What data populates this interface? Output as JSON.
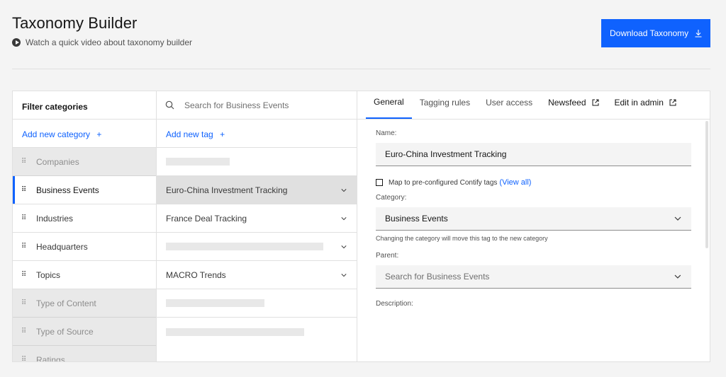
{
  "header": {
    "title": "Taxonomy Builder",
    "video_link": "Watch a quick video about taxonomy builder",
    "download_label": "Download Taxonomy"
  },
  "categories": {
    "header": "Filter categories",
    "add_label": "Add new category",
    "items": [
      {
        "label": "Companies",
        "state": "disabled"
      },
      {
        "label": "Business Events",
        "state": "active"
      },
      {
        "label": "Industries",
        "state": "normal"
      },
      {
        "label": "Headquarters",
        "state": "normal"
      },
      {
        "label": "Topics",
        "state": "normal"
      },
      {
        "label": "Type of Content",
        "state": "disabled"
      },
      {
        "label": "Type of Source",
        "state": "disabled"
      },
      {
        "label": "Ratings",
        "state": "disabled"
      }
    ]
  },
  "tags": {
    "search_placeholder": "Search for Business Events",
    "add_label": "Add new tag",
    "items": [
      {
        "label": "",
        "skeleton": true
      },
      {
        "label": "Euro-China Investment Tracking",
        "selected": true
      },
      {
        "label": "France Deal Tracking"
      },
      {
        "label": "",
        "skeleton": true
      },
      {
        "label": "MACRO Trends"
      },
      {
        "label": "",
        "skeleton": true
      },
      {
        "label": "",
        "skeleton": true
      }
    ]
  },
  "details": {
    "tabs": [
      {
        "label": "General",
        "active": true
      },
      {
        "label": "Tagging rules"
      },
      {
        "label": "User access"
      },
      {
        "label": "Newsfeed",
        "external": true
      },
      {
        "label": "Edit in admin",
        "external": true
      }
    ],
    "name_label": "Name:",
    "name_value": "Euro-China Investment Tracking",
    "map_text": "Map to pre-configured Contify tags",
    "view_all": "(View all)",
    "category_label": "Category:",
    "category_value": "Business Events",
    "category_helper": "Changing the category will move this tag to the new category",
    "parent_label": "Parent:",
    "parent_placeholder": "Search for Business Events",
    "description_label": "Description:"
  },
  "colors": {
    "primary": "#0f62fe",
    "selected_row": "#e0e0e0",
    "disabled_bg": "#e9e9e9"
  }
}
